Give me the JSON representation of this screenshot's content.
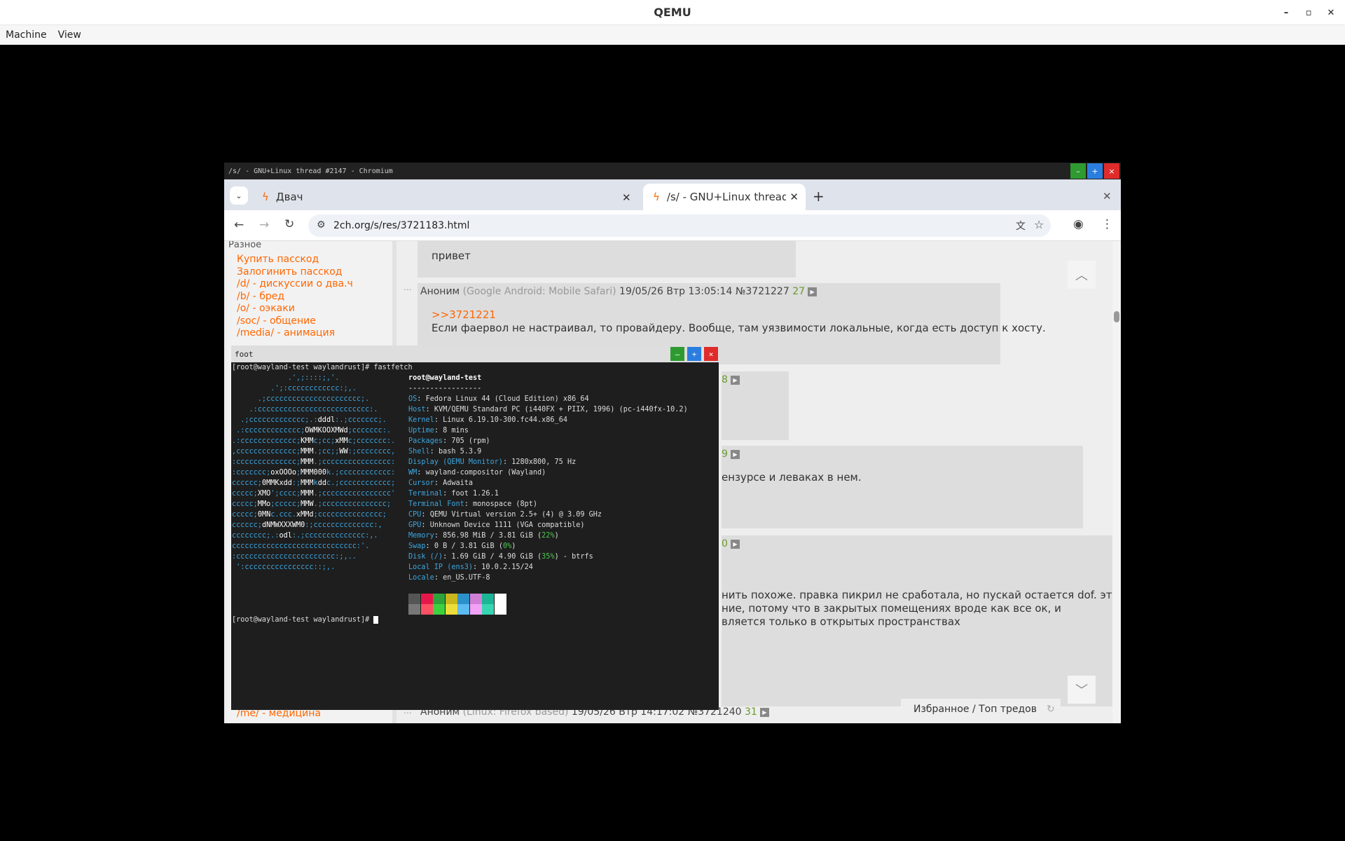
{
  "qemu": {
    "title": "QEMU",
    "menu": [
      "Machine",
      "View"
    ]
  },
  "chromium": {
    "window_title": "/s/ - GNU+Linux thread #2147 - Chromium",
    "tabs": [
      {
        "label": "Двач"
      },
      {
        "label": "/s/ - GNU+Linux thread"
      }
    ],
    "url": "2ch.org/s/res/3721183.html"
  },
  "sidebar": {
    "section": "Разное",
    "links": [
      "Купить пасскод",
      "Залогинить пасскод",
      "/d/ - дискуссии о два.ч",
      "/b/ - бред",
      "/o/ - оэкаки",
      "/soc/ - общение",
      "/media/ - анимация"
    ],
    "bottom_link": "/me/ - медицина"
  },
  "posts": [
    {
      "text": "привет"
    },
    {
      "author": "Аноним",
      "ua": "(Google Android: Mobile Safari)",
      "date": "19/05/26 Втр 13:05:14",
      "num": "№3721227",
      "count": "27",
      "reply": ">>3721221",
      "text": "Если фаервол не настраивал, то провайдеру. Вообще, там уязвимости локальные, когда есть доступ к хосту."
    },
    {
      "count_frag": "8"
    },
    {
      "count_frag": "9",
      "text_frag": "ензурсе и леваках в нем."
    },
    {
      "count_frag": "0",
      "lines": [
        "нить похоже. правка пикрил не сработала, но пускай остается dof. это",
        "ние, потому что в закрытых помещениях вроде как все ок, и",
        "вляется только в открытых пространствах"
      ]
    },
    {
      "author": "Аноним",
      "ua": "(Linux: Firefox based)",
      "date": "19/05/26 Втр 14:17:02",
      "num": "№3721240",
      "count": "31"
    }
  ],
  "favorites_label": "Избранное / Топ тредов",
  "terminal": {
    "title": "foot",
    "prompt": "[root@wayland-test waylandrust]# ",
    "command": "fastfetch",
    "final_prompt": "[root@wayland-test waylandrust]# ",
    "user_host": "root@wayland-test",
    "separator": "-----------------",
    "logo": [
      "             .',;::::;,'.",
      "         .';:cccccccccccc:;,.",
      "      .;cccccccccccccccccccccc;.",
      "    .:cccccccccccccccccccccccccc:.",
      "  .;ccccccccccccc;.:dddl:.;ccccccc;.",
      " .:ccccccccccccc;OWMKOOXMWd;ccccccc:.",
      ".:ccccccccccccc;KMMc;cc;xMMc;ccccccc:.",
      ",cccccccccccccc;MMM.;cc;;WW:;cccccccc,",
      ":cccccccccccccc;MMM.;cccccccccccccccc:",
      ":ccccccc;oxOOOo;MMM000k.;cccccccccccc:",
      "cccccc;0MMKxdd:;MMMkddc.;cccccccccccc;",
      "ccccc;XMO';cccc;MMM.;cccccccccccccccc'",
      "ccccc;MMo;ccccc;MMW.;ccccccccccccccc;",
      "ccccc;0MNc.ccc.xMMd;ccccccccccccccc;",
      "cccccc;dNMWXXXWM0:;cccccccccccccc:,",
      "cccccccc;.:odl:.;cccccccccccccc:,.",
      "ccccccccccccccccccccccccccccc:'.",
      ":ccccccccccccccccccccccc:;,..",
      " ':cccccccccccccccc::;,."
    ],
    "info": [
      {
        "key": "OS",
        "value": "Fedora Linux 44 (Cloud Edition) x86_64"
      },
      {
        "key": "Host",
        "value": "KVM/QEMU Standard PC (i440FX + PIIX, 1996) (pc-i440fx-10.2)"
      },
      {
        "key": "Kernel",
        "value": "Linux 6.19.10-300.fc44.x86_64"
      },
      {
        "key": "Uptime",
        "value": "8 mins"
      },
      {
        "key": "Packages",
        "value": "705 (rpm)"
      },
      {
        "key": "Shell",
        "value": "bash 5.3.9"
      },
      {
        "key": "Display (QEMU Monitor)",
        "value": "1280x800, 75 Hz"
      },
      {
        "key": "WM",
        "value": "wayland-compositor (Wayland)"
      },
      {
        "key": "Cursor",
        "value": "Adwaita"
      },
      {
        "key": "Terminal",
        "value": "foot 1.26.1"
      },
      {
        "key": "Terminal Font",
        "value": "monospace (8pt)"
      },
      {
        "key": "CPU",
        "value": "QEMU Virtual version 2.5+ (4) @ 3.09 GHz"
      },
      {
        "key": "GPU",
        "value": "Unknown Device 1111 (VGA compatible)"
      },
      {
        "key": "Memory",
        "value": "856.98 MiB / 3.81 GiB (",
        "pct": "22%",
        "tail": ")"
      },
      {
        "key": "Swap",
        "value": "0 B / 3.81 GiB (",
        "pct": "0%",
        "tail": ")"
      },
      {
        "key": "Disk (/)",
        "value": "1.69 GiB / 4.90 GiB (",
        "pct": "35%",
        "tail": ") - btrfs"
      },
      {
        "key": "Local IP (ens3)",
        "value": "10.0.2.15/24"
      },
      {
        "key": "Locale",
        "value": "en_US.UTF-8"
      }
    ],
    "palette_top": [
      "#555555",
      "#e8174a",
      "#2ea33b",
      "#c9b51c",
      "#2b91c8",
      "#d17fd6",
      "#1bb595",
      "#ffffff"
    ],
    "palette_bottom": [
      "#777777",
      "#ff4f63",
      "#3ed13e",
      "#ecdd3a",
      "#5cbbf0",
      "#f2a1f4",
      "#36d6b0",
      "#ffffff"
    ]
  },
  "colors": {
    "link": "#ff6600",
    "term_key": "#3ca6e0",
    "term_pct": "#4ec94e",
    "win_min": "#2e9a30",
    "win_max": "#2b7de0",
    "win_close": "#e02b2b"
  }
}
